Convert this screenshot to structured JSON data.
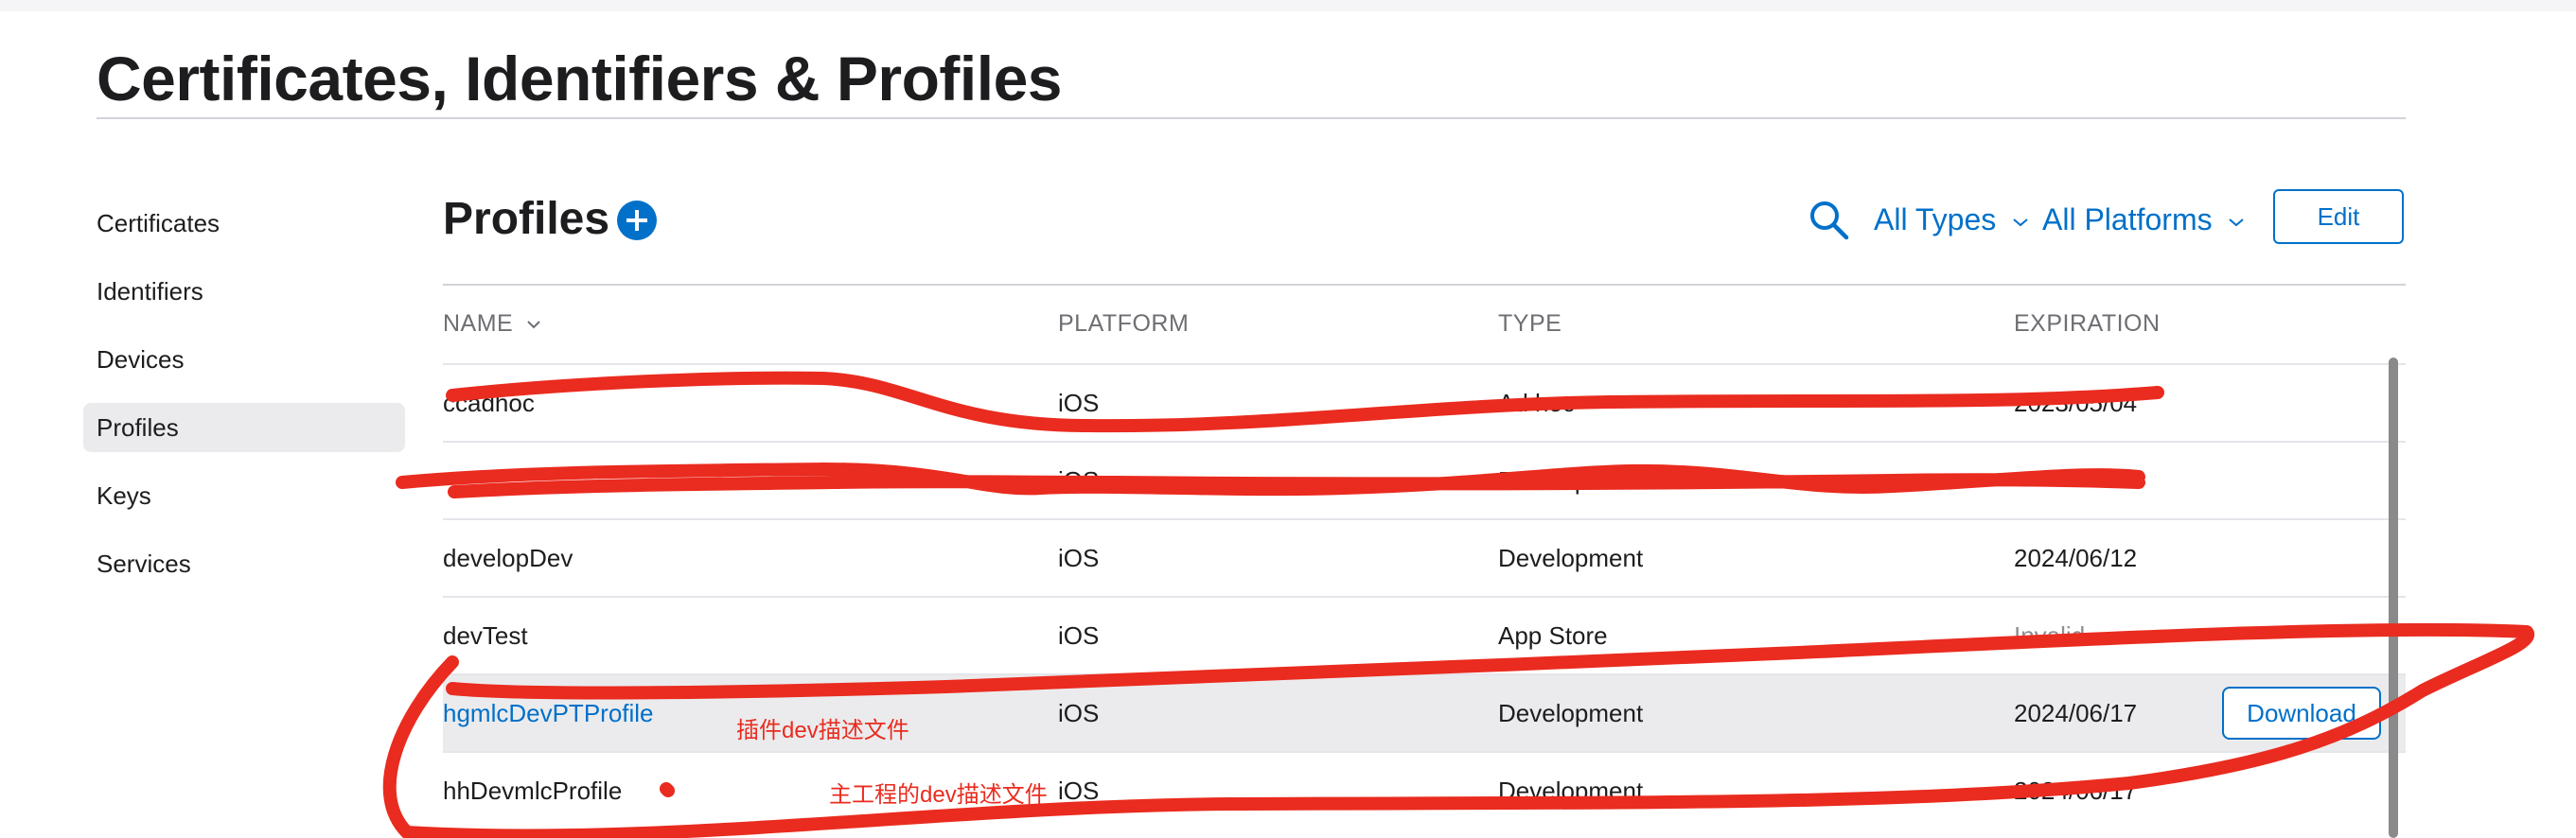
{
  "page": {
    "title": "Certificates, Identifiers & Profiles"
  },
  "sidebar": {
    "items": [
      {
        "label": "Certificates",
        "active": false
      },
      {
        "label": "Identifiers",
        "active": false
      },
      {
        "label": "Devices",
        "active": false
      },
      {
        "label": "Profiles",
        "active": true
      },
      {
        "label": "Keys",
        "active": false
      },
      {
        "label": "Services",
        "active": false
      }
    ]
  },
  "section": {
    "title": "Profiles",
    "add_icon": "plus-circle-icon",
    "search_icon": "search-icon",
    "filter_types": "All Types",
    "filter_platforms": "All Platforms",
    "edit_label": "Edit"
  },
  "table": {
    "columns": [
      "NAME",
      "PLATFORM",
      "TYPE",
      "EXPIRATION"
    ],
    "sort_icon": "chevron-down-icon",
    "rows": [
      {
        "name": "ccadhoc",
        "platform": "iOS",
        "type": "Ad hoc",
        "expiration": "2023/05/04"
      },
      {
        "name": "",
        "platform": "iOS",
        "type": "Development",
        "expiration": ""
      },
      {
        "name": "developDev",
        "platform": "iOS",
        "type": "Development",
        "expiration": "2024/06/12"
      },
      {
        "name": "devTest",
        "platform": "iOS",
        "type": "App Store",
        "expiration": "Invalid"
      },
      {
        "name": "hgmlcDevPTProfile",
        "platform": "iOS",
        "type": "Development",
        "expiration": "2024/06/17",
        "action": "Download"
      },
      {
        "name": "hhDevmlcProfile",
        "platform": "iOS",
        "type": "Development",
        "expiration": "2024/06/17"
      }
    ]
  },
  "annotations": {
    "plugin_note": "插件dev描述文件",
    "main_note": "主工程的dev描述文件",
    "ink_color": "#ea2b1f"
  },
  "colors": {
    "accent": "#0070c9",
    "selected_row": "#ebebed"
  }
}
